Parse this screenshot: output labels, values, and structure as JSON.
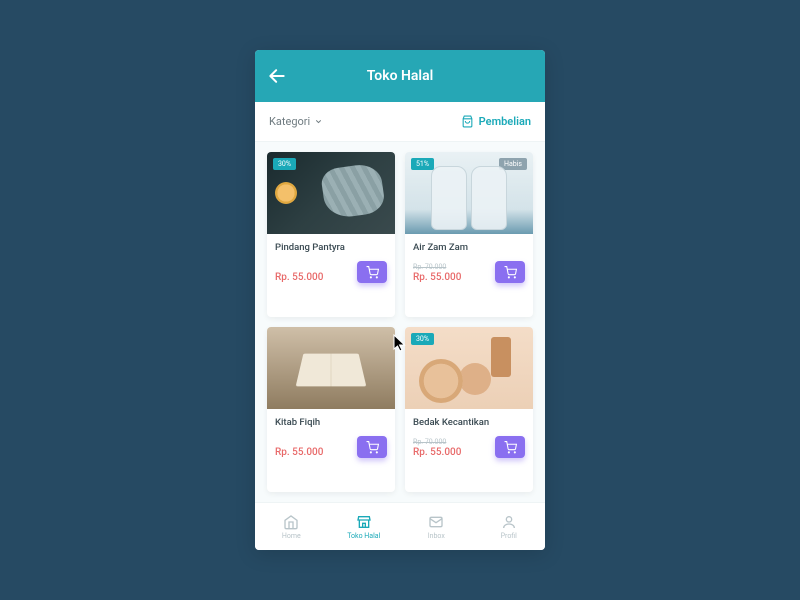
{
  "header": {
    "title": "Toko Halal"
  },
  "subbar": {
    "kategori": "Kategori",
    "pembelian": "Pembelian"
  },
  "products": [
    {
      "name": "Pindang Pantyra",
      "price": "Rp. 55.000",
      "old": "",
      "discount": "30%",
      "soldout": ""
    },
    {
      "name": "Air Zam Zam",
      "price": "Rp. 55.000",
      "old": "Rp. 70.000",
      "discount": "51%",
      "soldout": "Habis"
    },
    {
      "name": "Kitab Fiqih",
      "price": "Rp. 55.000",
      "old": "",
      "discount": "",
      "soldout": ""
    },
    {
      "name": "Bedak Kecantikan",
      "price": "Rp. 55.000",
      "old": "Rp. 70.000",
      "discount": "30%",
      "soldout": ""
    }
  ],
  "nav": {
    "home": "Home",
    "toko": "Toko Halal",
    "inbox": "Inbox",
    "profil": "Profil"
  }
}
